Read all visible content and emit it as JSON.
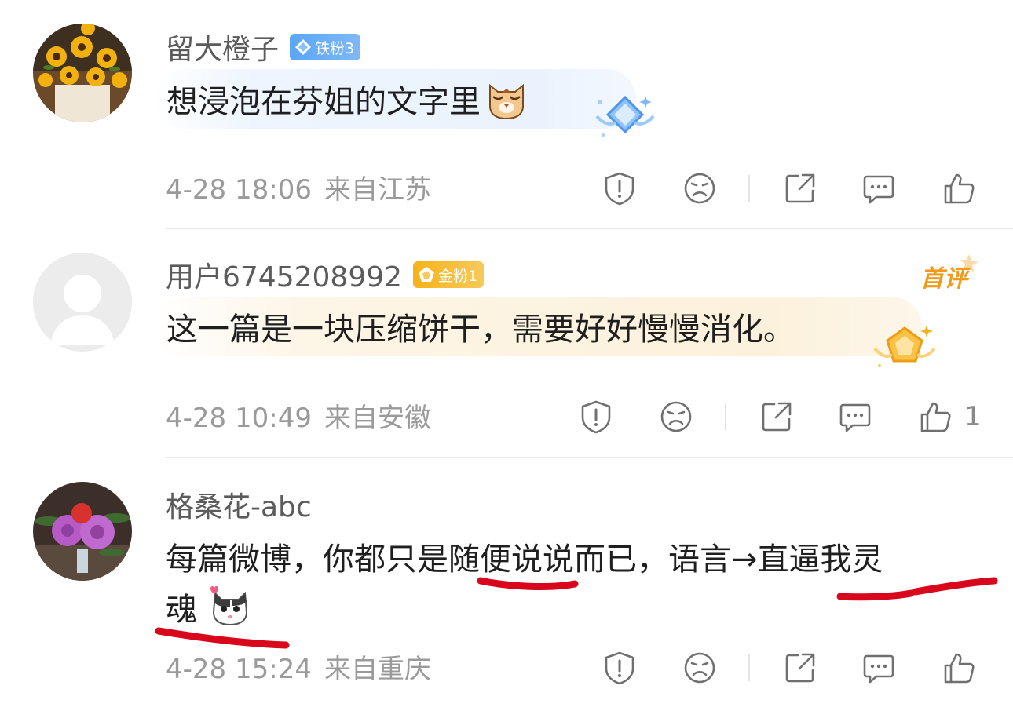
{
  "comments": [
    {
      "username": "留大橙子",
      "badge": {
        "label": "铁粉3",
        "color": "#5aa6f5",
        "icon": "diamond-icon"
      },
      "text": "想浸泡在芬姐的文字里",
      "emoji": "cat-face-emoji",
      "date": "4-28 18:06",
      "location": "来自江苏",
      "likes": ""
    },
    {
      "username": "用户6745208992",
      "badge": {
        "label": "金粉1",
        "color": "#f6b21a",
        "icon": "pentagon-icon"
      },
      "first_tag": "首评",
      "text": "这一篇是一块压缩饼干，需要好好慢慢消化。",
      "date": "4-28 10:49",
      "location": "来自安徽",
      "likes": "1"
    },
    {
      "username": "格桑花-abc",
      "text_line1": "每篇微博，你都只是随便说说而已，语言→直逼我灵",
      "text_line2": "魂",
      "emoji": "cat-heart-emoji",
      "date": "4-28 15:24",
      "location": "来自重庆",
      "likes": ""
    }
  ],
  "actions": [
    "report-icon",
    "dislike-icon",
    "share-icon",
    "reply-icon",
    "like-icon"
  ],
  "annotation_color": "#d9071c"
}
